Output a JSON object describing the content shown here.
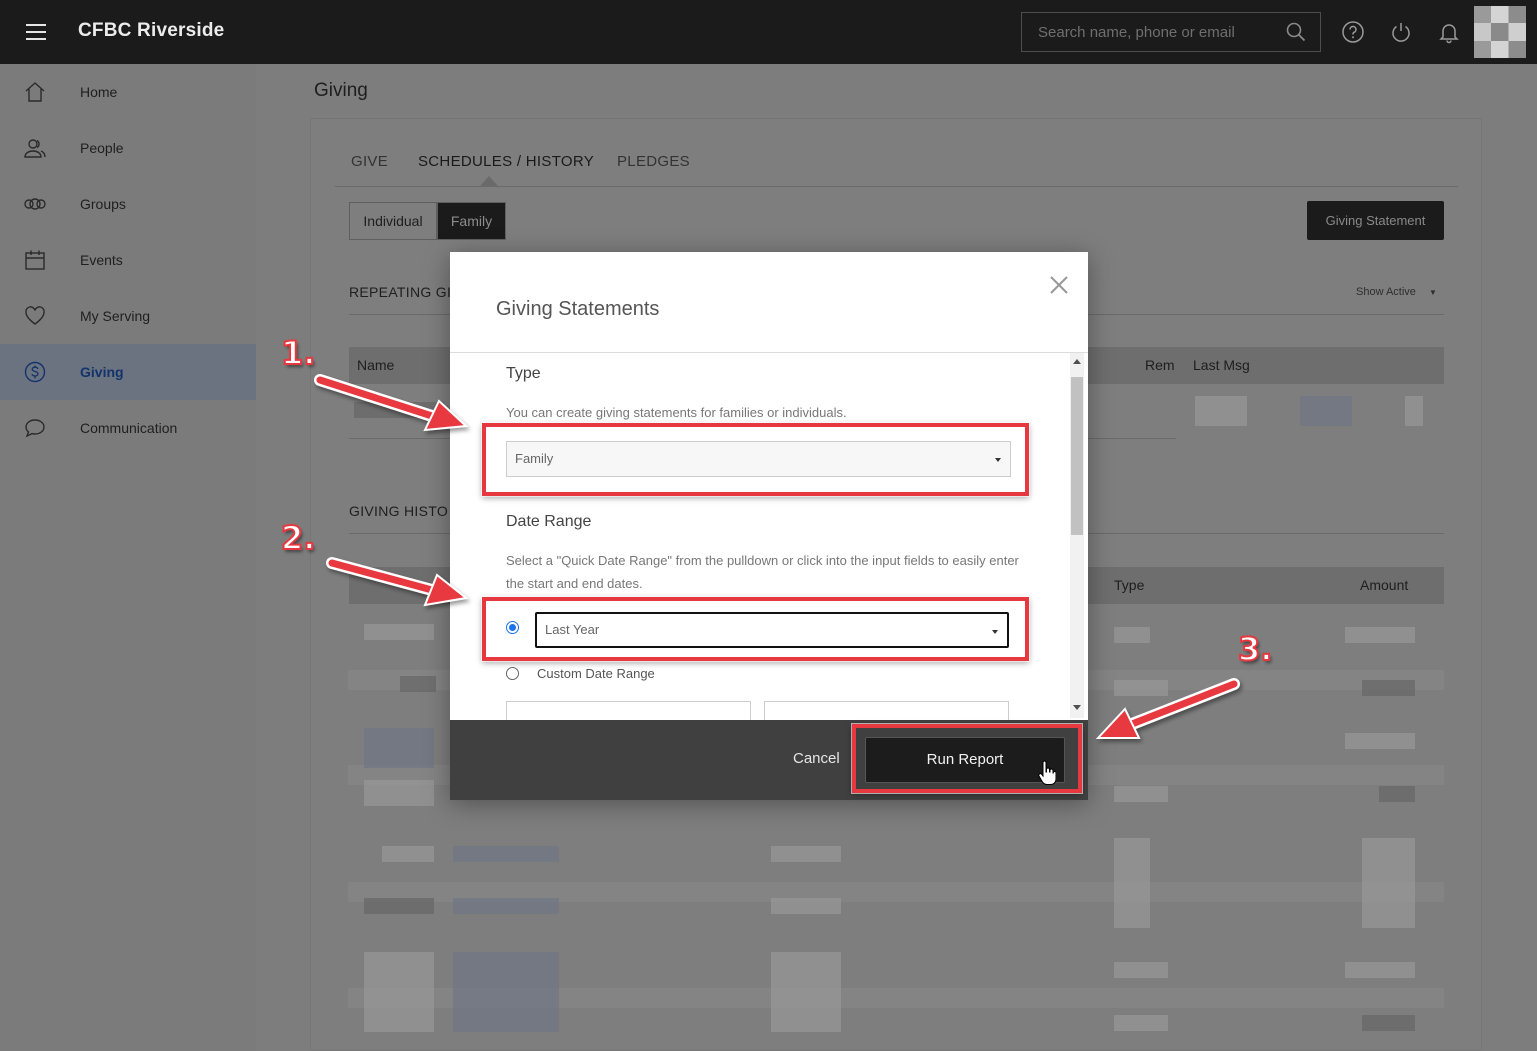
{
  "topbar": {
    "app_title": "CFBC Riverside",
    "search_placeholder": "Search name, phone or email",
    "icons": [
      "menu-icon",
      "search-icon",
      "help-icon",
      "power-icon",
      "bell-icon",
      "avatar"
    ]
  },
  "sidebar": {
    "items": [
      {
        "label": "Home",
        "icon": "home-icon"
      },
      {
        "label": "People",
        "icon": "people-icon"
      },
      {
        "label": "Groups",
        "icon": "groups-icon"
      },
      {
        "label": "Events",
        "icon": "calendar-icon"
      },
      {
        "label": "My Serving",
        "icon": "heart-icon"
      },
      {
        "label": "Giving",
        "icon": "dollar-icon",
        "active": true
      },
      {
        "label": "Communication",
        "icon": "chat-icon"
      }
    ]
  },
  "page": {
    "title": "Giving",
    "tabs": [
      {
        "label": "GIVE"
      },
      {
        "label": "SCHEDULES / HISTORY",
        "active": true
      },
      {
        "label": "PLEDGES"
      }
    ],
    "segment": {
      "individual": "Individual",
      "family": "Family",
      "selected": "Family"
    },
    "giving_statement_button": "Giving Statement",
    "repeating_section": "REPEATING GI",
    "show_active": "Show Active",
    "repeating_columns": {
      "name": "Name",
      "rem": "Rem",
      "last_msg": "Last Msg"
    },
    "history_section": "GIVING HISTO",
    "history_columns": {
      "type": "Type",
      "amount": "Amount"
    }
  },
  "modal": {
    "title": "Giving Statements",
    "type_heading": "Type",
    "type_help": "You can create giving statements for families or individuals.",
    "type_value": "Family",
    "date_heading": "Date Range",
    "date_help": "Select a \"Quick Date Range\" from the pulldown or click into the input fields to easily enter the start and end dates.",
    "quick_range_value": "Last Year",
    "custom_range_label": "Custom Date Range",
    "cancel": "Cancel",
    "run_report": "Run Report"
  },
  "annotations": {
    "step1": "1.",
    "step2": "2.",
    "step3": "3.",
    "color": "#e8383f"
  }
}
